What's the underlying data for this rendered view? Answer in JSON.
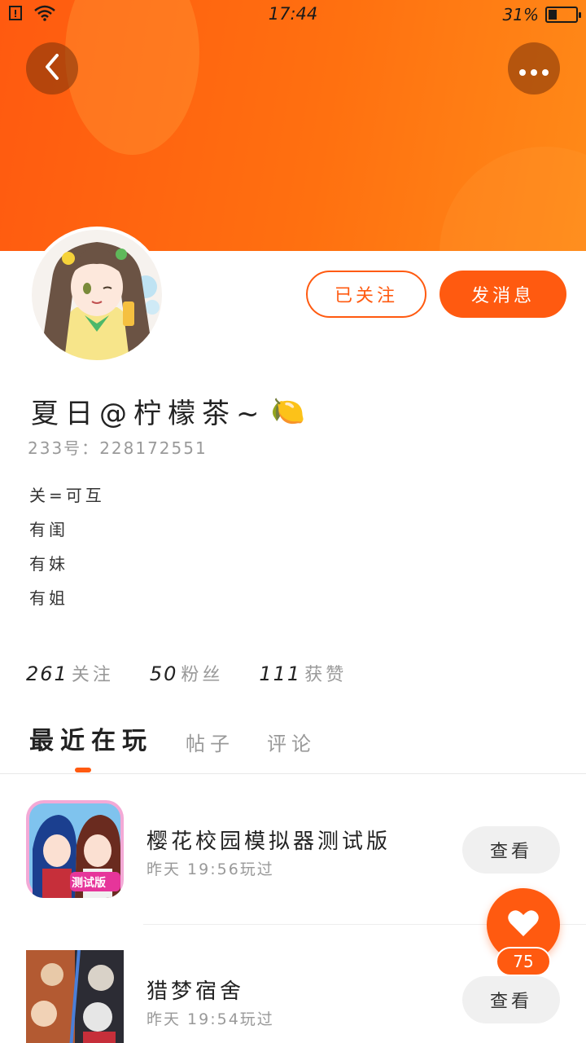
{
  "statusbar": {
    "time": "17:44",
    "battery_text": "31%",
    "battery_level": 0.31,
    "icons": [
      "notification-icon",
      "wifi-icon",
      "battery-icon"
    ]
  },
  "header": {
    "back_icon": "chevron-left-icon",
    "more_icon": "more-dots-icon",
    "more_label": "•••",
    "colors": {
      "accent": "#ff5a10",
      "accent_light": "#ff8a18"
    }
  },
  "actions": {
    "follow_label": "已关注",
    "message_label": "发消息"
  },
  "profile": {
    "name": "夏日@柠檬茶~",
    "name_emoji": "🍋",
    "uid_label": "233号：",
    "uid_value": "228172551",
    "bio": [
      "关=可互",
      "有闺",
      "有妹",
      "有姐"
    ]
  },
  "stats": [
    {
      "num": "261",
      "label": "关注"
    },
    {
      "num": "50",
      "label": "粉丝"
    },
    {
      "num": "111",
      "label": "获赞"
    }
  ],
  "tabs": [
    "最近在玩",
    "帖子",
    "评论"
  ],
  "games": [
    {
      "title": "樱花校园模拟器测试版",
      "time": "昨天 19:56玩过",
      "view_label": "查看",
      "icon_badge": "测试版"
    },
    {
      "title": "猎梦宿舍",
      "time": "昨天 19:54玩过",
      "view_label": "查看"
    }
  ],
  "like": {
    "count": "75",
    "icon": "heart-icon"
  }
}
